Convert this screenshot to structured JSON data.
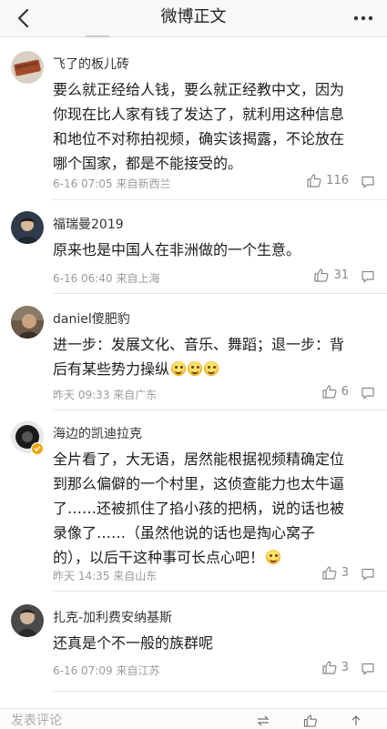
{
  "header": {
    "title": "微博正文"
  },
  "comments": [
    {
      "name": "飞了的板儿砖",
      "text": "要么就正经给人钱，要么就正经教中文，因为\n你现在比人家有钱了发达了，就利用这种信息\n和地位不对称拍视频，确实该揭露，不论放在\n哪个国家，都是不能接受的。",
      "meta": "6-16 07:05  来自新西兰",
      "likes": "116"
    },
    {
      "name": "福瑞曼2019",
      "text": "原来也是中国人在非洲做的一个生意。",
      "meta": "6-16 06:40  来自上海",
      "likes": "31"
    },
    {
      "name": "daniel傻肥豹",
      "text": "进一步：发展文化、音乐、舞蹈；退一步：背\n后有某些势力操纵",
      "meta": "昨天 09:33  来自广东",
      "likes": "6"
    },
    {
      "name": "海边的凯迪拉克",
      "text": "全片看了，大无语，居然能根据视频精确定位\n到那么偏僻的一个村里，这侦查能力也太牛逼\n了……还被抓住了掐小孩的把柄，说的话也被\n录像了……（虽然他说的话也是掏心窝子\n的），以后干这种事可长点心吧！",
      "meta": "昨天 14:35  来自山东",
      "likes": "3"
    },
    {
      "name": "扎克-加利费安纳基斯",
      "text": "还真是个不一般的族群呢",
      "meta": "6-16 07:09  来自江苏",
      "likes": "3"
    }
  ],
  "footer": {
    "compose_placeholder": "发表评论"
  },
  "colors": {
    "text": "#1c1c1c",
    "meta": "#9a9a9a",
    "badge": "#f0a500"
  }
}
